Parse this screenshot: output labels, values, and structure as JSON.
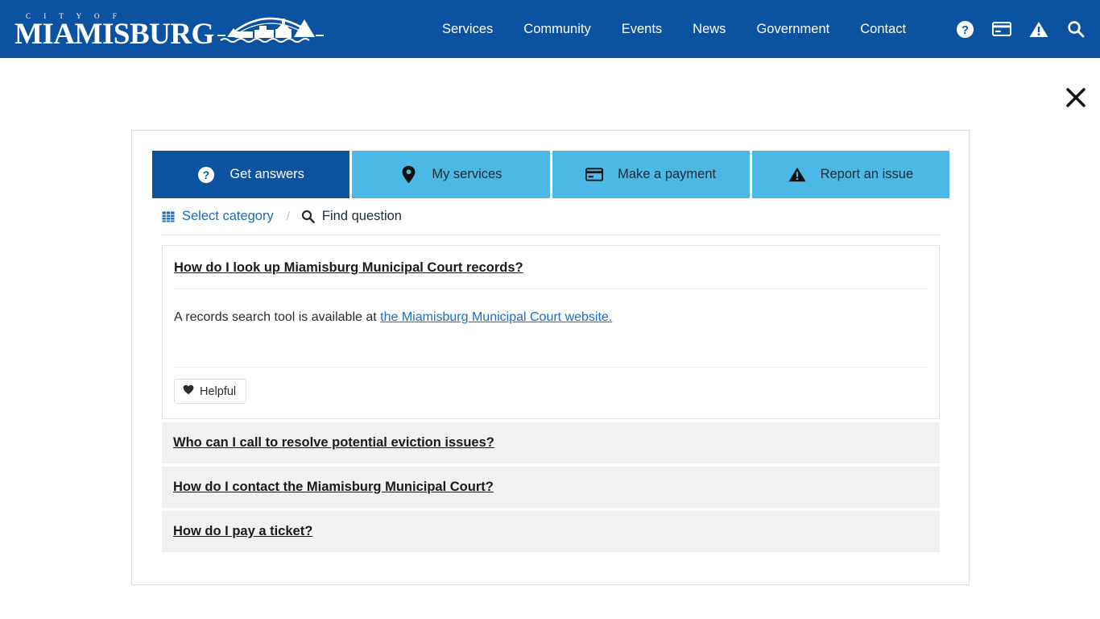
{
  "header": {
    "logo": {
      "eyebrow": "C I T Y   O F",
      "wordmark": "MIAMISBURG",
      "art_icon": "riverfront-skyline-icon"
    },
    "nav_links": [
      {
        "label": "Services"
      },
      {
        "label": "Community"
      },
      {
        "label": "Events"
      },
      {
        "label": "News"
      },
      {
        "label": "Government"
      },
      {
        "label": "Contact"
      }
    ],
    "nav_icons": [
      {
        "name": "question-circle-icon"
      },
      {
        "name": "credit-card-icon"
      },
      {
        "name": "warning-triangle-icon"
      },
      {
        "name": "search-icon"
      }
    ],
    "background_color": "#0b52a1"
  },
  "close_button": {
    "name": "close-icon",
    "label": "×"
  },
  "widget": {
    "tabs": [
      {
        "label": "Get answers",
        "icon": "question-circle-icon",
        "active": true
      },
      {
        "label": "My services",
        "icon": "map-pin-icon",
        "active": false
      },
      {
        "label": "Make a payment",
        "icon": "credit-card-icon",
        "active": false
      },
      {
        "label": "Report an issue",
        "icon": "warning-triangle-icon",
        "active": false
      }
    ],
    "active_tab_color": "#0b52a1",
    "inactive_tab_color": "#4cb8e5",
    "filters": {
      "select_category": "Select category",
      "select_category_icon": "grid-icon",
      "separator": "/",
      "find_question": "Find question",
      "find_question_icon": "search-icon"
    },
    "faq": {
      "expanded": {
        "question": "How do I look up Miamisburg Municipal Court records?",
        "answer_prefix": "A records search tool is available at ",
        "answer_link": "the Miamisburg Municipal Court website.",
        "helpful_label": "Helpful",
        "helpful_icon": "heart-icon"
      },
      "collapsed": [
        {
          "question": "Who can I call to resolve potential eviction issues?"
        },
        {
          "question": "How do I contact the Miamisburg Municipal Court?"
        },
        {
          "question": "How do I pay a ticket?"
        }
      ]
    }
  }
}
